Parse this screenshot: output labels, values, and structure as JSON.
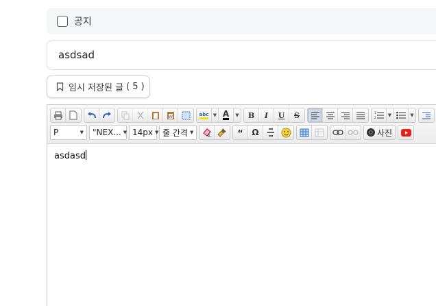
{
  "notice": {
    "label": "공지"
  },
  "title": {
    "value": "asdsad"
  },
  "temp_saved": {
    "label": "임시 저장된 글",
    "count": "( 5 )"
  },
  "toolbar": {
    "format_block": "P",
    "font_family": "\"NEX...",
    "font_size": "14px",
    "line_height": "줄 간격",
    "photo_label": "사진",
    "quote_label": "“",
    "omega_label": "Ω",
    "bold_label": "B",
    "italic_label": "I",
    "underline_label": "U",
    "strike_label": "S",
    "font_color_label": "A",
    "highlight_label": "abc"
  },
  "editor": {
    "content": "asdasd"
  },
  "colors": {
    "accent": "#2b6cb0",
    "youtube": "#e62117"
  }
}
